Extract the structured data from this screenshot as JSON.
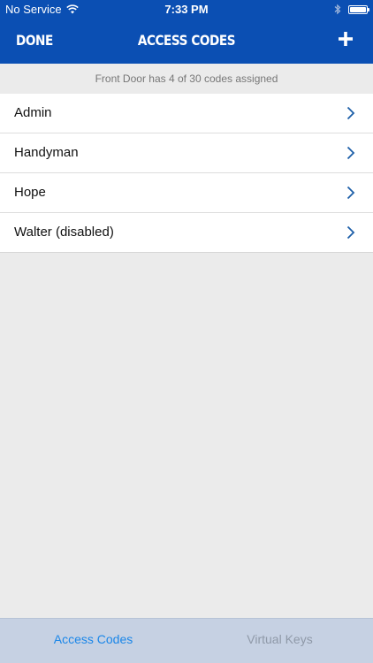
{
  "status_bar": {
    "carrier": "No Service",
    "time": "7:33 PM"
  },
  "nav": {
    "done_label": "DONE",
    "title": "ACCESS CODES",
    "add_icon": "plus-icon"
  },
  "subtitle": "Front Door has 4 of 30 codes assigned",
  "codes": [
    {
      "label": "Admin"
    },
    {
      "label": "Handyman"
    },
    {
      "label": "Hope"
    },
    {
      "label": "Walter (disabled)"
    }
  ],
  "tabs": [
    {
      "label": "Access Codes",
      "active": true
    },
    {
      "label": "Virtual Keys",
      "active": false
    }
  ],
  "colors": {
    "header_blue": "#0b4fb3",
    "chevron_blue": "#1d5fa8",
    "tab_active": "#1a86e8",
    "tab_inactive": "#8f99a8",
    "tab_bar_bg": "#c6d1e3",
    "page_bg": "#ebebeb"
  }
}
